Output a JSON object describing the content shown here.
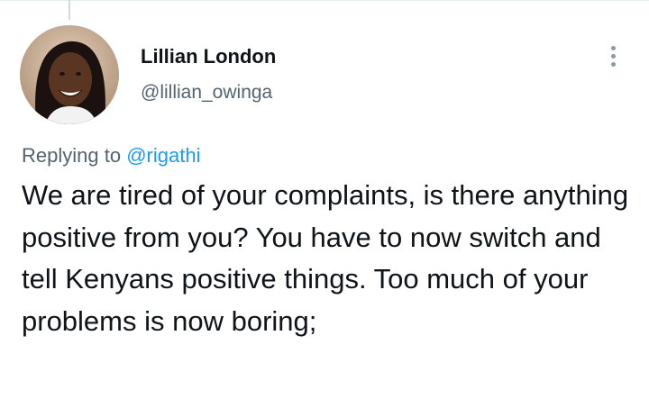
{
  "tweet": {
    "author": {
      "display_name": "Lillian London",
      "handle": "@lillian_owinga"
    },
    "more_icon": "more-vertical-icon",
    "replying_prefix": "Replying to",
    "replying_to": "@rigathi",
    "text": "We are tired of your complaints, is there anything positive from you? You have to now switch and tell Kenyans positive things. Too much of your problems is now boring;"
  },
  "colors": {
    "text": "#0f1419",
    "secondary_text": "#536471",
    "link": "#1d9bf0",
    "icon": "#8b98a5",
    "thread_line": "#cfd9de"
  }
}
